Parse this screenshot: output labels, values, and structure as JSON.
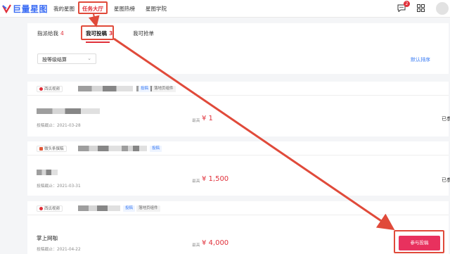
{
  "nav": {
    "logo_text": "巨量星图",
    "items": [
      "我的星图",
      "任务大厅",
      "星图热榜",
      "星图学院"
    ],
    "message_count": "2"
  },
  "tabs": [
    {
      "label": "指派给我",
      "count": "4"
    },
    {
      "label": "我可投稿",
      "count": "3"
    },
    {
      "label": "我可抢单",
      "count": ""
    }
  ],
  "filters": {
    "sort_select": "按等级结算",
    "default_sort": "默认排序"
  },
  "tasks": [
    {
      "source": "西瓜视频",
      "tags": [
        {
          "text": "投稿",
          "style": "blue"
        },
        {
          "text": "落地页组件",
          "style": "gray"
        }
      ],
      "title": "",
      "deadline": "投稿截止：2021-03-28",
      "price_label": "最高",
      "price": "¥ 1",
      "status": "已参与"
    },
    {
      "source": "微头条撰稿",
      "tags": [
        {
          "text": "投稿",
          "style": "blue"
        }
      ],
      "title": "",
      "deadline": "投稿截止：2021-03-31",
      "price_label": "最高",
      "price": "¥ 1,500",
      "status": "已参与"
    },
    {
      "source": "西瓜视频",
      "tags": [
        {
          "text": "投稿",
          "style": "blue"
        },
        {
          "text": "落地页组件",
          "style": "gray"
        }
      ],
      "title": "掌上网咖",
      "deadline": "投稿截止：2021-04-22",
      "price_label": "最高",
      "price": "¥ 4,000",
      "status": "",
      "button": "参与投稿"
    }
  ],
  "colors": {
    "accent_red": "#e0303a",
    "button_pink": "#e8315e",
    "annotation_red": "#e04a3a",
    "link_blue": "#3a7cf4"
  }
}
